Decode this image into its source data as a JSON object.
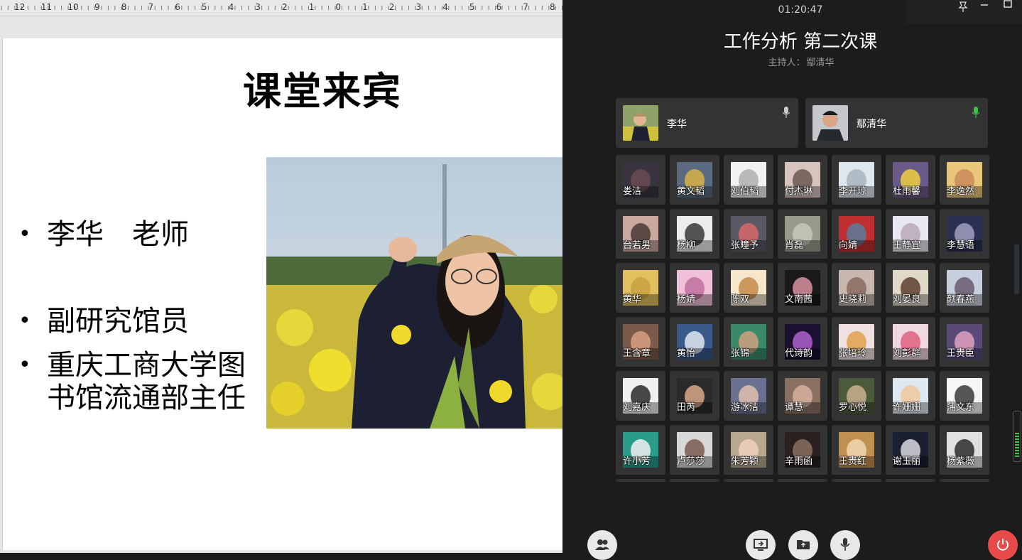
{
  "ruler": {
    "labels": [
      "12",
      "11",
      "10",
      "9",
      "8",
      "7",
      "6",
      "5",
      "4",
      "3",
      "2",
      "1",
      "0",
      "1",
      "2",
      "3",
      "4",
      "5",
      "6",
      "7",
      "8"
    ]
  },
  "slide": {
    "title": "课堂来宾",
    "bullets": [
      {
        "marker": "•",
        "lines": [
          "李华　老师"
        ]
      },
      {
        "marker": "•",
        "lines": [
          "副研究馆员"
        ]
      },
      {
        "marker": "•",
        "lines": [
          "重庆工商大学图",
          "书馆流通部主任"
        ]
      }
    ]
  },
  "meeting": {
    "timer": "01:20:47",
    "title": "工作分析 第二次课",
    "host_label": "主持人：",
    "host_name": "鄢清华",
    "speakers": [
      {
        "name": "李华",
        "mic_color": "#cccccc"
      },
      {
        "name": "鄢清华",
        "mic_color": "#3fc24a"
      }
    ],
    "participants": [
      [
        "娄洁",
        "黄文韬",
        "刘伯韬",
        "付杰琳",
        "李开琼",
        "杜雨馨",
        "李逸然"
      ],
      [
        "台若男",
        "杨柳",
        "张瞳予",
        "肖磊",
        "向婧",
        "王静宜",
        "李慧语"
      ],
      [
        "黄华",
        "杨婧",
        "陈双",
        "文南茜",
        "史晓莉",
        "刘晏良",
        "颜春燕"
      ],
      [
        "王含章",
        "黄怡",
        "张锦",
        "代诗韵",
        "张培玲",
        "刘彭群",
        "王贵臣"
      ],
      [
        "刘嘉庆",
        "田芮",
        "游冰洁",
        "谭慧",
        "罗心悦",
        "许姗姗",
        "蒲文东"
      ],
      [
        "许小芳",
        "卢莎莎",
        "朱芳颖",
        "辛雨函",
        "王贵红",
        "谢玉丽",
        "杨紫薇"
      ]
    ]
  },
  "colors": {
    "leave": "#e84a4a",
    "mic_active": "#3fc24a",
    "tile_bg": "#333333"
  }
}
